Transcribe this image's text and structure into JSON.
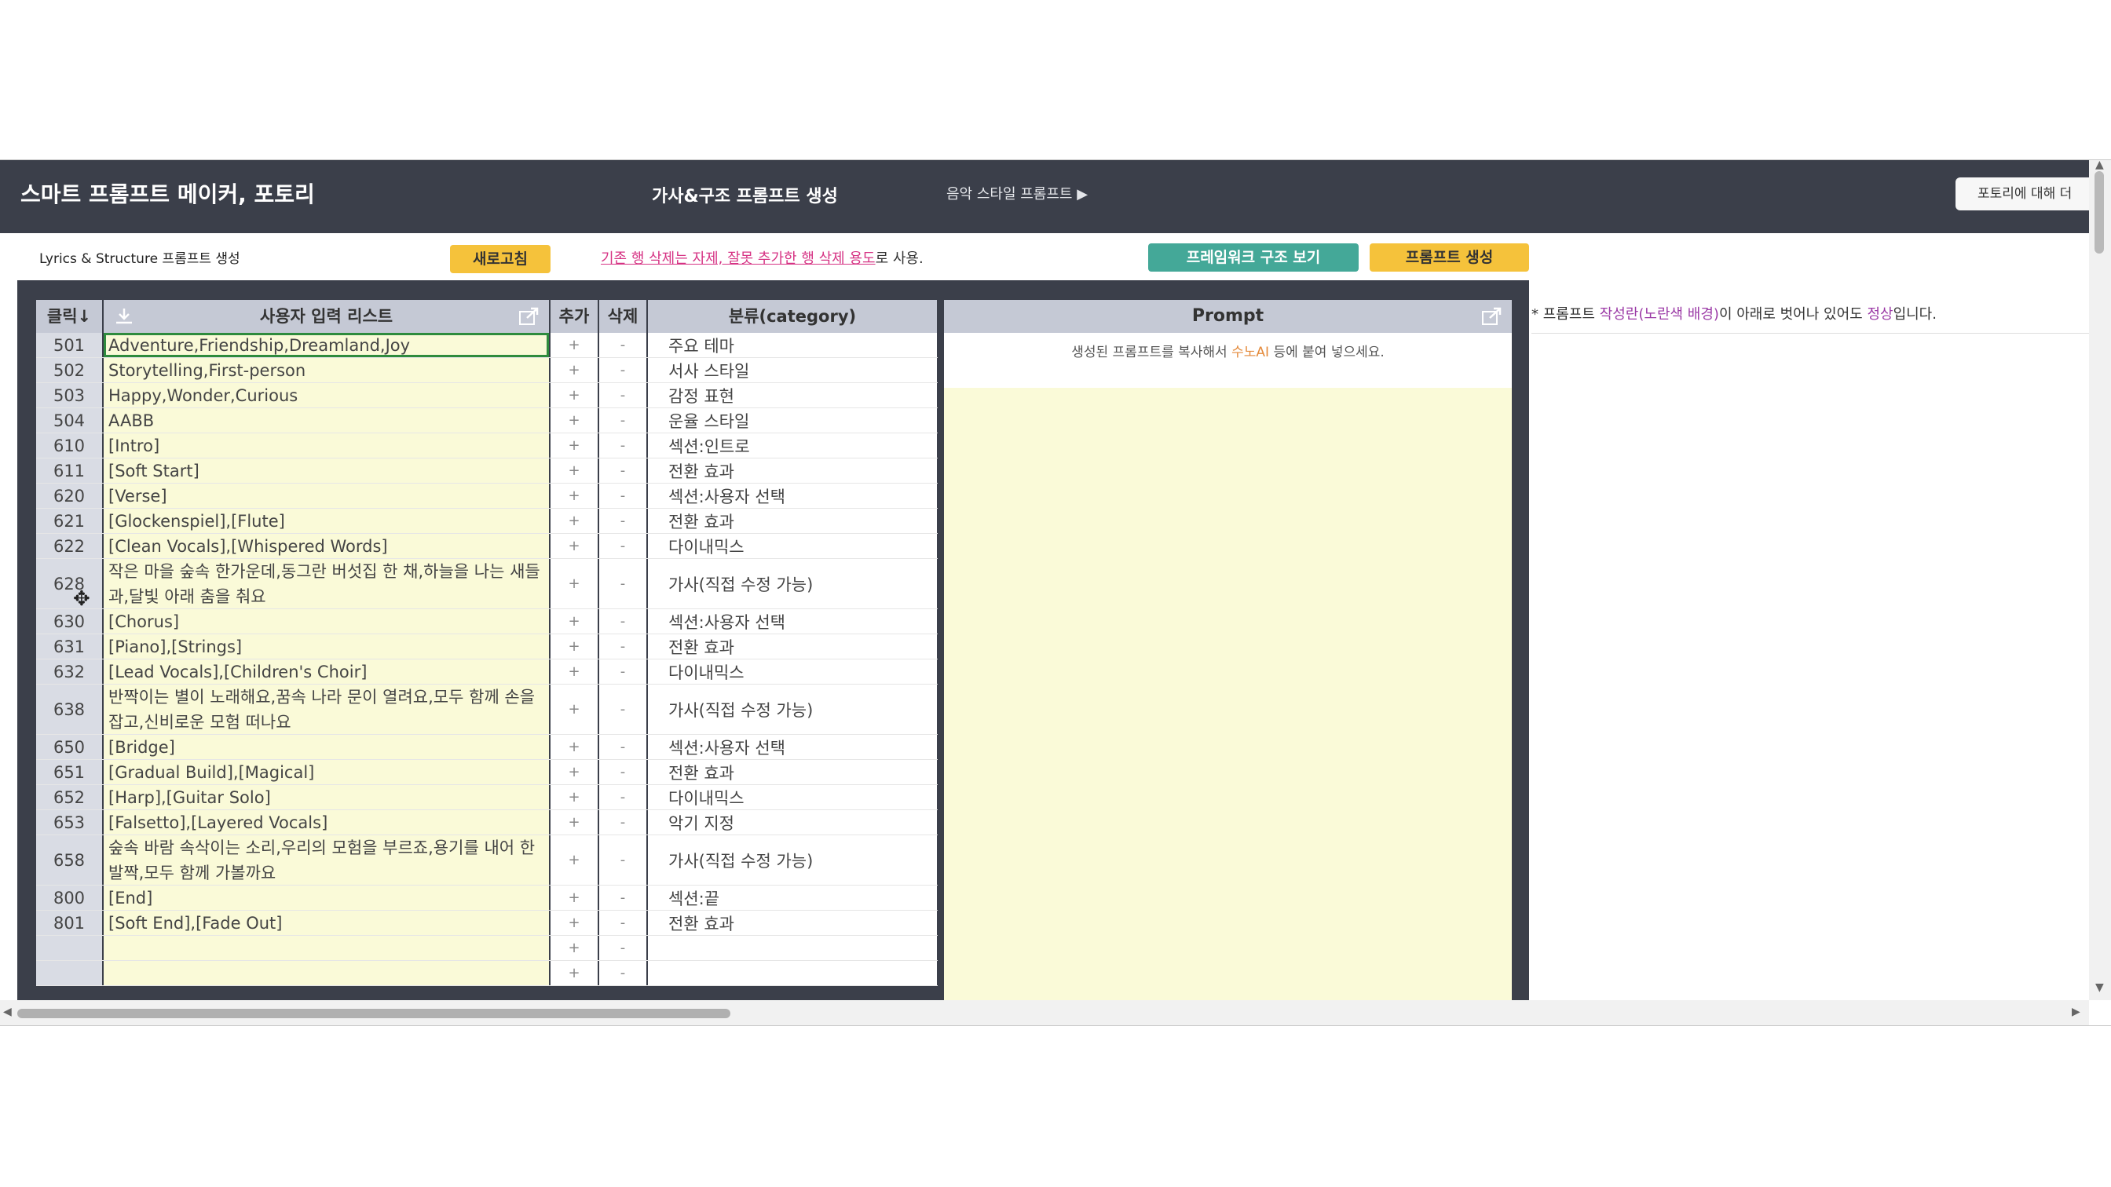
{
  "header": {
    "app_title": "스마트 프롬프트 메이커, 포토리",
    "center_title": "가사&구조 프롬프트 생성",
    "music_style_link": "음악 스타일 프롬프트 ▶",
    "about_button": "포토리에 대해 더"
  },
  "toolbar": {
    "subtitle": "Lyrics & Structure 프롬프트 생성",
    "refresh_button": "새로고침",
    "delete_note_link": "기존 행 삭제는 자제, 잘못 추가한 행 삭제 용도",
    "delete_note_tail": "로 사용.",
    "framework_button": "프레임워크 구조 보기",
    "generate_button": "프롬프트 생성"
  },
  "side_note": {
    "prefix": "* 프롬프트 ",
    "highlight1": "작성란(노란색 배경)",
    "middle": "이 아래로 벗어나 있어도 ",
    "highlight2": "정상",
    "suffix": "입니다."
  },
  "table": {
    "headers": {
      "num": "클릭↓",
      "list": "사용자 입력 리스트",
      "add": "추가",
      "delete": "삭제",
      "category": "분류(category)"
    },
    "add_symbol": "+",
    "delete_symbol": "-",
    "rows": [
      {
        "num": "501",
        "value": "Adventure,Friendship,Dreamland,Joy",
        "category": "주요 테마"
      },
      {
        "num": "502",
        "value": "Storytelling,First-person",
        "category": "서사 스타일"
      },
      {
        "num": "503",
        "value": "Happy,Wonder,Curious",
        "category": "감정 표현"
      },
      {
        "num": "504",
        "value": "AABB",
        "category": "운율 스타일"
      },
      {
        "num": "610",
        "value": "[Intro]",
        "category": "섹션:인트로"
      },
      {
        "num": "611",
        "value": "[Soft Start]",
        "category": "전환 효과"
      },
      {
        "num": "620",
        "value": "[Verse]",
        "category": "섹션:사용자 선택"
      },
      {
        "num": "621",
        "value": "[Glockenspiel],[Flute]",
        "category": "전환 효과"
      },
      {
        "num": "622",
        "value": "[Clean Vocals],[Whispered Words]",
        "category": "다이내믹스"
      },
      {
        "num": "628",
        "value": "작은 마을 숲속 한가운데,동그란 버섯집 한 채,하늘을 나는 새들과,달빛 아래 춤을 춰요",
        "category": "가사(직접 수정 가능)"
      },
      {
        "num": "630",
        "value": "[Chorus]",
        "category": "섹션:사용자 선택"
      },
      {
        "num": "631",
        "value": "[Piano],[Strings]",
        "category": "전환 효과"
      },
      {
        "num": "632",
        "value": "[Lead Vocals],[Children's Choir]",
        "category": "다이내믹스"
      },
      {
        "num": "638",
        "value": "반짝이는 별이 노래해요,꿈속 나라 문이 열려요,모두 함께 손을 잡고,신비로운 모험 떠나요",
        "category": "가사(직접 수정 가능)"
      },
      {
        "num": "650",
        "value": "[Bridge]",
        "category": "섹션:사용자 선택"
      },
      {
        "num": "651",
        "value": "[Gradual Build],[Magical]",
        "category": "전환 효과"
      },
      {
        "num": "652",
        "value": "[Harp],[Guitar Solo]",
        "category": "다이내믹스"
      },
      {
        "num": "653",
        "value": "[Falsetto],[Layered Vocals]",
        "category": "악기 지정"
      },
      {
        "num": "658",
        "value": "숲속 바람 속삭이는 소리,우리의 모험을 부르죠,용기를 내어 한 발짝,모두 함께 가볼까요",
        "category": "가사(직접 수정 가능)"
      },
      {
        "num": "800",
        "value": "[End]",
        "category": "섹션:끝"
      },
      {
        "num": "801",
        "value": "[Soft End],[Fade Out]",
        "category": "전환 효과"
      },
      {
        "num": "",
        "value": "",
        "category": ""
      },
      {
        "num": "",
        "value": "",
        "category": ""
      }
    ]
  },
  "prompt_panel": {
    "title": "Prompt",
    "hint_prefix": "생성된 프롬프트를 복사해서 ",
    "hint_highlight": "수노AI",
    "hint_suffix": " 등에 붙여 넣으세요."
  },
  "colors": {
    "dark_header": "#3b3f4a",
    "yellow_button": "#f5c23b",
    "teal_button": "#44a898",
    "input_background": "#fafad8",
    "header_gray": "#c5c9d5"
  }
}
